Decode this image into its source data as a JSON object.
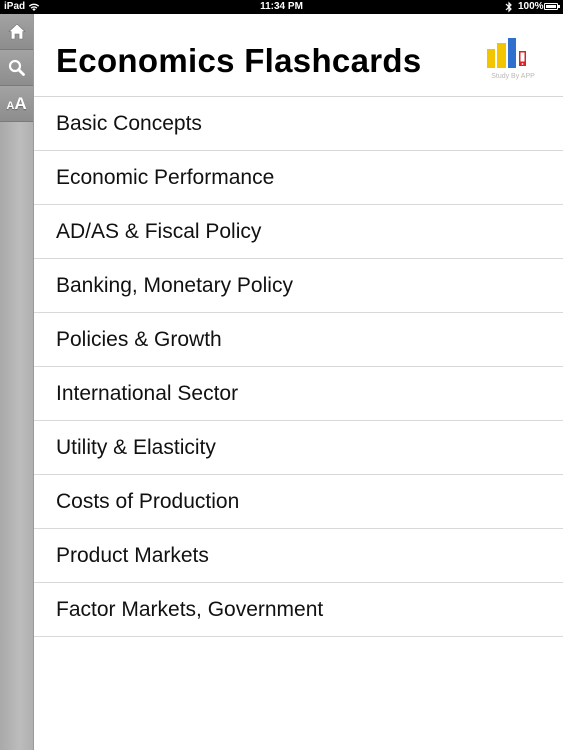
{
  "status_bar": {
    "device": "iPad",
    "time": "11:34 PM",
    "battery": "100%"
  },
  "sidebar": {
    "home_icon": "home-icon",
    "search_icon": "search-icon",
    "font_size_small": "A",
    "font_size_big": "A"
  },
  "header": {
    "title": "Economics Flashcards",
    "logo_caption": "Study By APP"
  },
  "colors": {
    "logo_yellow": "#f2c500",
    "logo_blue": "#2f6fce",
    "logo_red": "#d8232a"
  },
  "topics": [
    {
      "label": "Basic Concepts"
    },
    {
      "label": "Economic Performance"
    },
    {
      "label": "AD/AS & Fiscal Policy"
    },
    {
      "label": "Banking, Monetary Policy"
    },
    {
      "label": "Policies & Growth"
    },
    {
      "label": "International Sector"
    },
    {
      "label": "Utility & Elasticity"
    },
    {
      "label": "Costs of Production"
    },
    {
      "label": "Product Markets"
    },
    {
      "label": "Factor Markets, Government"
    }
  ]
}
